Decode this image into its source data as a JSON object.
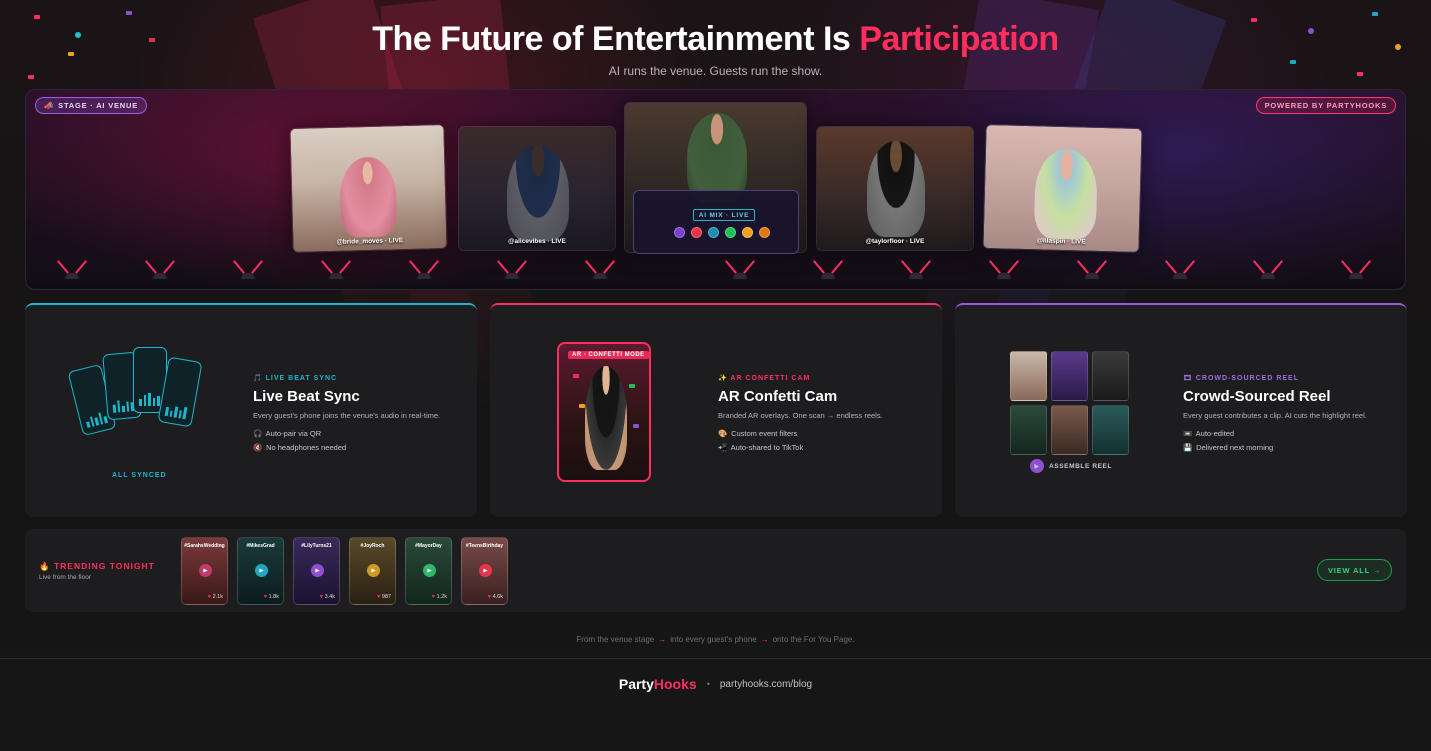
{
  "header": {
    "title_main": "The Future of Entertainment Is ",
    "title_accent": "Participation",
    "subtitle": "AI runs the venue. Guests run the show."
  },
  "stage": {
    "left_pill_icon": "megaphone-icon",
    "left_pill": "STAGE · AI VENUE",
    "right_pill": "POWERED BY PARTYHOOKS",
    "feeds": [
      {
        "handle": "@bride_moves · LIVE"
      },
      {
        "handle": "@alicevibes · LIVE"
      },
      {
        "handle": ""
      },
      {
        "handle": "@taylorfloor · LIVE"
      },
      {
        "handle": "@lilaspin · LIVE"
      }
    ],
    "ai_mix_label": "AI MIX · LIVE",
    "mix_colors": [
      "#7b3fd0",
      "#e8334a",
      "#1a8fb0",
      "#1fbf5a",
      "#f0a020",
      "#e07a10"
    ]
  },
  "features": {
    "beat": {
      "eyebrow": "🎵 LIVE BEAT SYNC",
      "title": "Live Beat Sync",
      "desc": "Every guest's phone joins the venue's audio in real-time.",
      "bullet1_icon": "🎧",
      "bullet1": "Auto-pair via QR",
      "bullet2_icon": "🔇",
      "bullet2": "No headphones needed",
      "caption": "ALL SYNCED"
    },
    "ar": {
      "eyebrow": "✨ AR CONFETTI CAM",
      "title": "AR Confetti Cam",
      "desc": "Branded AR overlays. One scan → endless reels.",
      "bullet1_icon": "🎨",
      "bullet1": "Custom event filters",
      "bullet2_icon": "📲",
      "bullet2": "Auto-shared to TikTok",
      "phone_badge": "AR · CONFETTI MODE"
    },
    "reel": {
      "eyebrow": "🎞 CROWD-SOURCED REEL",
      "title": "Crowd-Sourced Reel",
      "desc": "Every guest contributes a clip. AI cuts the highlight reel.",
      "bullet1_icon": "📼",
      "bullet1": "Auto-edited",
      "bullet2_icon": "💾",
      "bullet2": "Delivered next morning",
      "caption": "ASSEMBLE REEL"
    }
  },
  "trending": {
    "title": "🔥 TRENDING TONIGHT",
    "subtitle": "Live from the floor",
    "clips": [
      {
        "tag": "#SarahsWedding",
        "likes": "2.1k",
        "color": "#c23a6a"
      },
      {
        "tag": "#MikesGrad",
        "likes": "1.8k",
        "color": "#1fa6c0"
      },
      {
        "tag": "#LilyTurns21",
        "likes": "3.4k",
        "color": "#8e4fd1"
      },
      {
        "tag": "#JoyRoch",
        "likes": "987",
        "color": "#d09a20"
      },
      {
        "tag": "#MayorDay",
        "likes": "1.2k",
        "color": "#2eb868"
      },
      {
        "tag": "#TeensBirthday",
        "likes": "4.6k",
        "color": "#e8334a"
      }
    ],
    "view_all": "VIEW ALL →"
  },
  "flow": {
    "part1": "From the venue stage",
    "part2": "into every guest's phone",
    "part3": "onto the For You Page."
  },
  "footer": {
    "brand_a": "Party",
    "brand_b": "Hooks",
    "sep": "•",
    "link": "partyhooks.com/blog"
  }
}
